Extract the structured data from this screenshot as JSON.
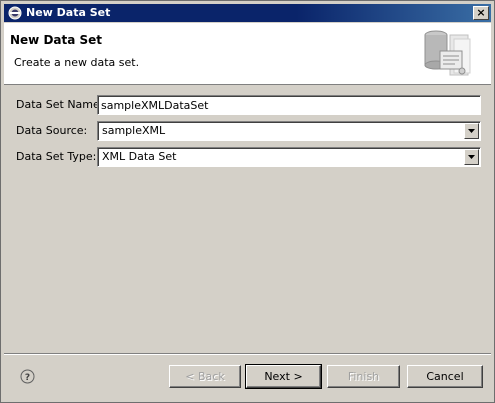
{
  "window": {
    "title": "New Data Set",
    "close_glyph": "×"
  },
  "banner": {
    "title": "New Data Set",
    "description": "Create a new data set.",
    "icon": "database-wizard-icon"
  },
  "form": {
    "name_label": "Data Set Name:",
    "name_value": "sampleXMLDataSet",
    "source_label": "Data Source:",
    "source_value": "sampleXML",
    "type_label": "Data Set Type:",
    "type_value": "XML Data Set"
  },
  "buttons": {
    "back": "< Back",
    "next": "Next >",
    "finish": "Finish",
    "cancel": "Cancel"
  },
  "colors": {
    "titlebar": "#0a246a",
    "dialog_bg": "#d4d0c8"
  }
}
